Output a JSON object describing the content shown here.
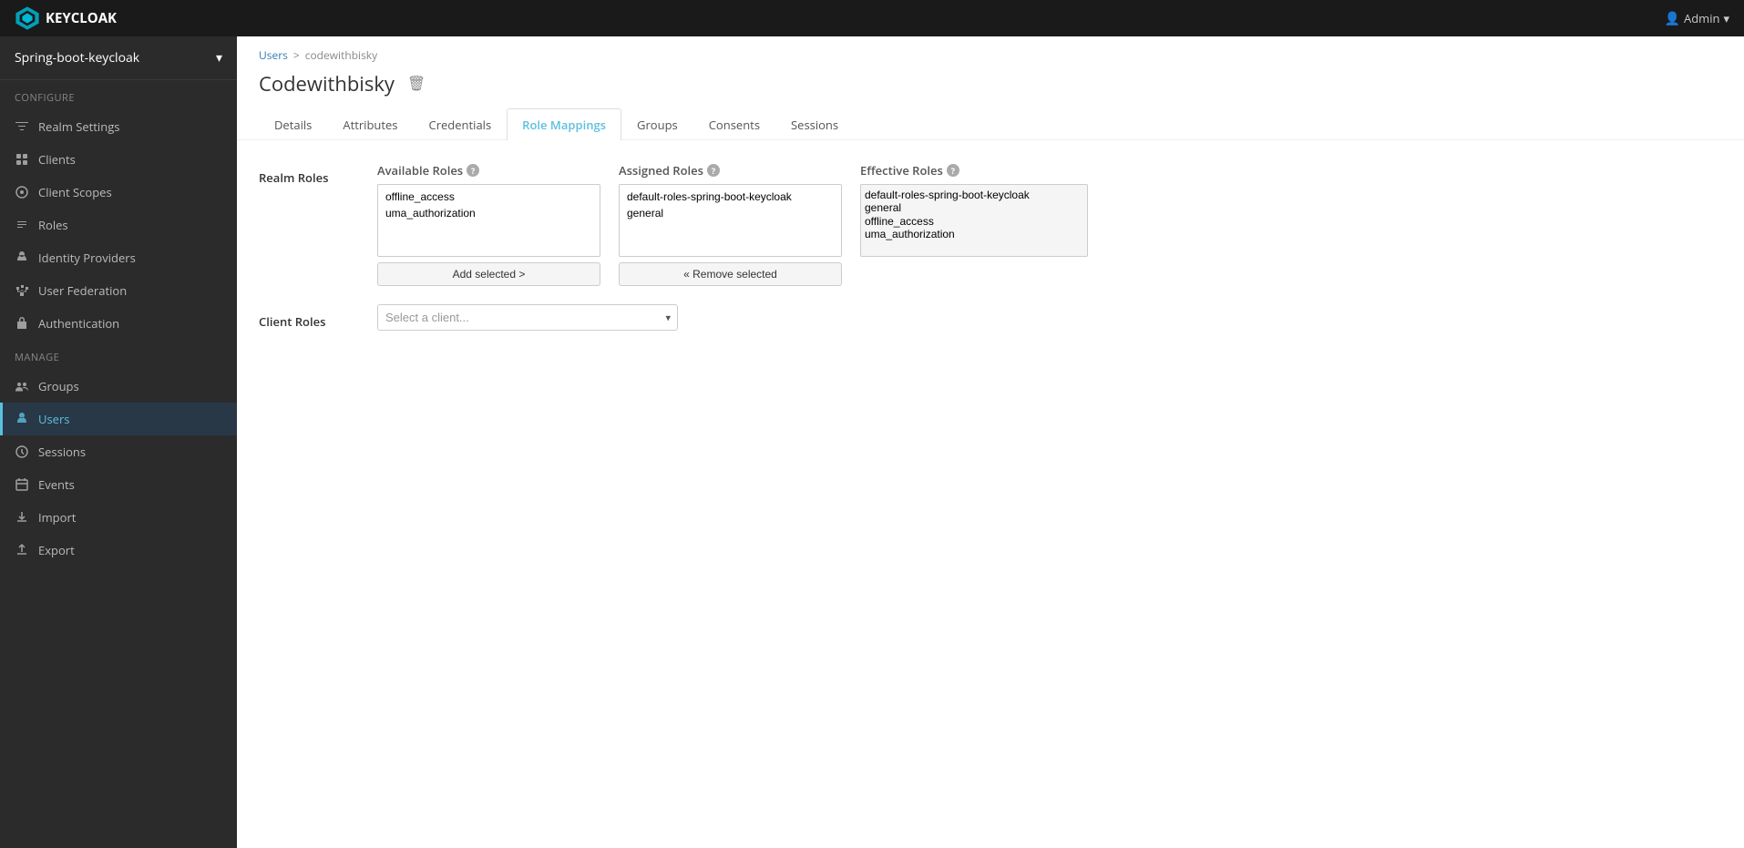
{
  "topbar": {
    "brand": "KEYCLOAK",
    "user_label": "Admin",
    "user_dropdown_arrow": "▾"
  },
  "sidebar": {
    "realm_name": "Spring-boot-keycloak",
    "realm_arrow": "▾",
    "configure_label": "Configure",
    "manage_label": "Manage",
    "configure_items": [
      {
        "id": "realm-settings",
        "label": "Realm Settings",
        "icon": "sliders"
      },
      {
        "id": "clients",
        "label": "Clients",
        "icon": "clients"
      },
      {
        "id": "client-scopes",
        "label": "Client Scopes",
        "icon": "scope"
      },
      {
        "id": "roles",
        "label": "Roles",
        "icon": "roles"
      },
      {
        "id": "identity-providers",
        "label": "Identity Providers",
        "icon": "identity"
      },
      {
        "id": "user-federation",
        "label": "User Federation",
        "icon": "federation"
      },
      {
        "id": "authentication",
        "label": "Authentication",
        "icon": "lock"
      }
    ],
    "manage_items": [
      {
        "id": "groups",
        "label": "Groups",
        "icon": "groups"
      },
      {
        "id": "users",
        "label": "Users",
        "icon": "user",
        "active": true
      },
      {
        "id": "sessions",
        "label": "Sessions",
        "icon": "sessions"
      },
      {
        "id": "events",
        "label": "Events",
        "icon": "events"
      },
      {
        "id": "import",
        "label": "Import",
        "icon": "import"
      },
      {
        "id": "export",
        "label": "Export",
        "icon": "export"
      }
    ]
  },
  "breadcrumb": {
    "parent_label": "Users",
    "separator": ">",
    "current": "codewithbisky"
  },
  "page_title": "Codewithbisky",
  "delete_tooltip": "Delete",
  "tabs": [
    {
      "id": "details",
      "label": "Details"
    },
    {
      "id": "attributes",
      "label": "Attributes"
    },
    {
      "id": "credentials",
      "label": "Credentials"
    },
    {
      "id": "role-mappings",
      "label": "Role Mappings",
      "active": true
    },
    {
      "id": "groups",
      "label": "Groups"
    },
    {
      "id": "consents",
      "label": "Consents"
    },
    {
      "id": "sessions",
      "label": "Sessions"
    }
  ],
  "role_mappings": {
    "realm_roles_label": "Realm Roles",
    "available_roles": {
      "header": "Available Roles",
      "items": [
        "offline_access",
        "uma_authorization"
      ]
    },
    "add_selected_btn": "Add selected >",
    "assigned_roles": {
      "header": "Assigned Roles",
      "items": [
        "default-roles-spring-boot-keycloak",
        "general"
      ]
    },
    "remove_selected_btn": "« Remove selected",
    "effective_roles": {
      "header": "Effective Roles",
      "items": [
        "default-roles-spring-boot-keycloak",
        "general",
        "offline_access",
        "uma_authorization"
      ]
    },
    "client_roles_label": "Client Roles",
    "client_select_placeholder": "Select a client..."
  }
}
